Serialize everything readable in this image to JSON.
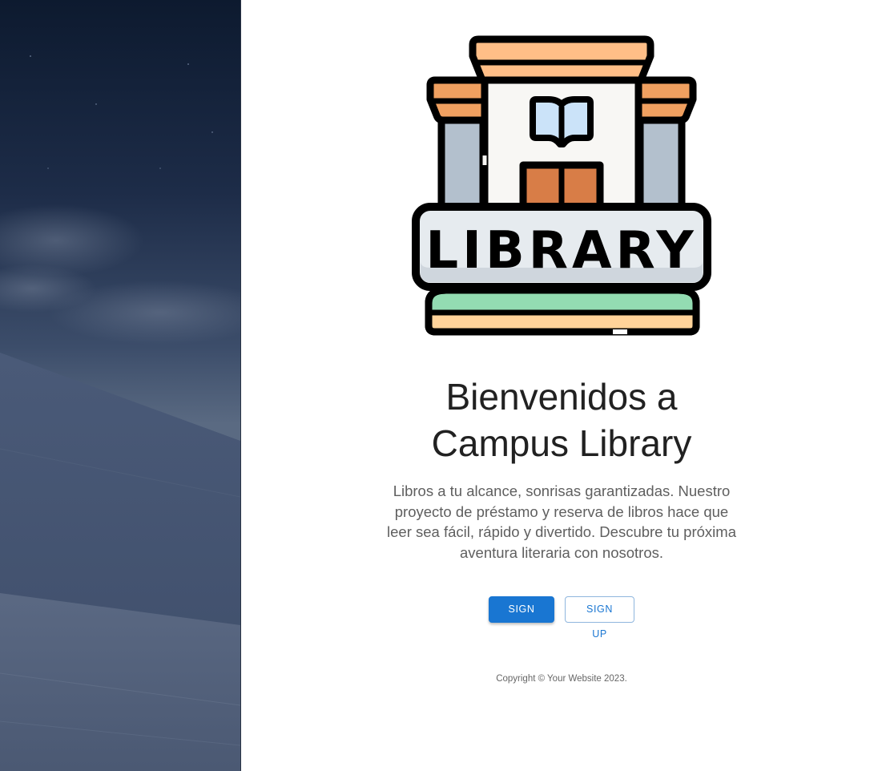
{
  "hero": {
    "title_line1": "Bienvenidos a",
    "title_line2": "Campus Library",
    "description": "Libros a tu alcance, sonrisas garantizadas. Nuestro proyecto de préstamo y reserva de libros hace que leer sea fácil, rápido y divertido. Descubre tu próxima aventura literaria con nosotros."
  },
  "logo": {
    "icon": "library-building-icon",
    "sign_text": "LIBRARY"
  },
  "side_image": {
    "icon": "night-desert-dunes-image"
  },
  "buttons": {
    "sign_in": "SIGN IN",
    "sign_up": "SIGN UP"
  },
  "footer": {
    "copyright": "Copyright © Your Website 2023."
  },
  "colors": {
    "primary": "#1976d2",
    "title_text": "#212121",
    "body_text": "#5f5f5f",
    "side_sky": "#1f2d45"
  }
}
